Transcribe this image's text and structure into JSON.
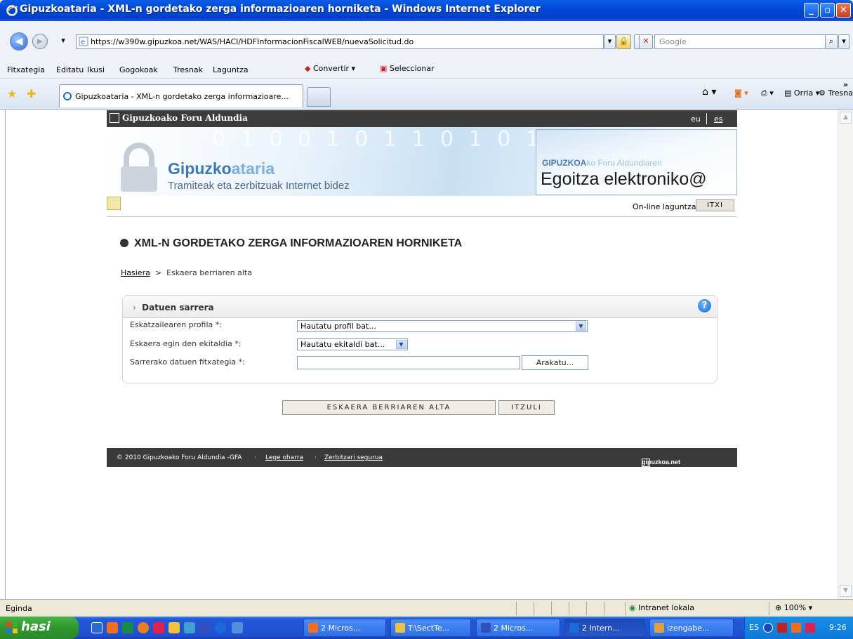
{
  "window": {
    "title": "Gipuzkoataria - XML-n gordetako zerga informazioaren horniketa - Windows Internet Explorer"
  },
  "address": {
    "url": "https://w390w.gipuzkoa.net/WAS/HACI/HDFInformacionFiscalWEB/nuevaSolicitud.do",
    "search_placeholder": "Google"
  },
  "menu": {
    "items": [
      "Fitxategia",
      "Editatu",
      "Ikusi",
      "Gogokoak",
      "Tresnak",
      "Laguntza"
    ],
    "convert_label": "Convertir",
    "select_label": "Seleccionar"
  },
  "tabs": {
    "active_label": "Gipuzkoataria - XML-n gordetako zerga informazioare...",
    "page_label": "Orria",
    "tools_label": "Tresnak"
  },
  "page": {
    "org_name": "Gipuzkoako Foru Aldundia",
    "lang_eu": "eu",
    "lang_es": "es",
    "banner_binary": "0 1 0 0 1 0 1 1 0 1 0 1 1",
    "brand_main": "Gipuzko",
    "brand_accent": "ataria",
    "brand_tagline": "Tramiteak eta zerbitzuak Internet bidez",
    "egoitza_line1_bold": "GIPUZKOA",
    "egoitza_line1_faded": "ko Foru Aldundiaren",
    "egoitza_line2": "Egoitza elektroniko@",
    "help_link": "On-line laguntza",
    "close_button": "ITXI",
    "heading": "XML-N GORDETAKO ZERGA INFORMAZIOAREN HORNIKETA",
    "breadcrumb_home": "Hasiera",
    "breadcrumb_sep": ">",
    "breadcrumb_current": "Eskaera berriaren alta"
  },
  "form": {
    "section_title": "Datuen sarrera",
    "profile_label": "Eskatzailearen profila",
    "profile_value": "Hautatu profil bat...",
    "period_label": "Eskaera egin den ekitaldia",
    "period_value": "Hautatu ekitaldi bat...",
    "file_label": "Sarrerako datuen fitxategia",
    "required_mark": "*:",
    "browse_button": "Arakatu...",
    "submit_button": "ESKAERA BERRIAREN ALTA",
    "back_button": "ITZULI"
  },
  "footer": {
    "copyright": "© 2010 Gipuzkoako Foru Aldundia -GFA",
    "legal_link": "Lege oharra",
    "secure_link": "Zerbitzari segurua",
    "dot": "·",
    "logo_text": "gipuzkoa.net"
  },
  "statusbar": {
    "status": "Egindа",
    "zone": "Intranet lokala",
    "zoom": "100%"
  },
  "taskbar": {
    "start_label": "hasi",
    "tasks": [
      "2 Micros...",
      "T:\\SectTe...",
      "2 Micros...",
      "2 Intern...",
      "izengabe..."
    ],
    "lang": "ES",
    "clock": "9:26"
  },
  "colors": {
    "title_blue": "#0148d8",
    "dark_bar": "#3c3c3c",
    "brand_blue": "#3c78b8"
  }
}
